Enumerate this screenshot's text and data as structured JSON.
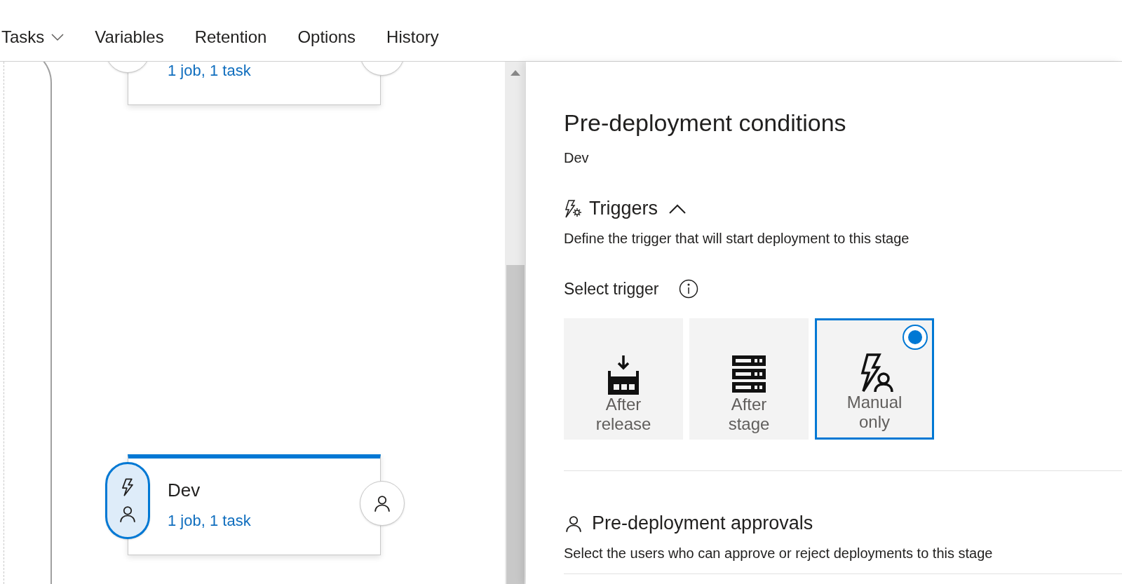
{
  "tabs": [
    {
      "label": "Tasks",
      "has_menu": true
    },
    {
      "label": "Variables",
      "has_menu": false
    },
    {
      "label": "Retention",
      "has_menu": false
    },
    {
      "label": "Options",
      "has_menu": false
    },
    {
      "label": "History",
      "has_menu": false
    }
  ],
  "stages": [
    {
      "summary": "1 job, 1 task",
      "selected": false,
      "trigger_icon": false
    },
    {
      "name": "Dev",
      "summary": "1 job, 1 task",
      "selected": true,
      "trigger_icon": true
    }
  ],
  "panel": {
    "title": "Pre-deployment conditions",
    "subtitle": "Dev",
    "triggers": {
      "title": "Triggers",
      "expanded": true,
      "description": "Define the trigger that will start deployment to this stage",
      "select_label": "Select trigger",
      "options": [
        {
          "label": "After release",
          "kind": "release",
          "selected": false
        },
        {
          "label": "After stage",
          "kind": "stage",
          "selected": false
        },
        {
          "label": "Manual only",
          "kind": "manual",
          "selected": true
        }
      ]
    },
    "approvals": {
      "title": "Pre-deployment approvals",
      "description": "Select the users who can approve or reject deployments to this stage"
    }
  }
}
